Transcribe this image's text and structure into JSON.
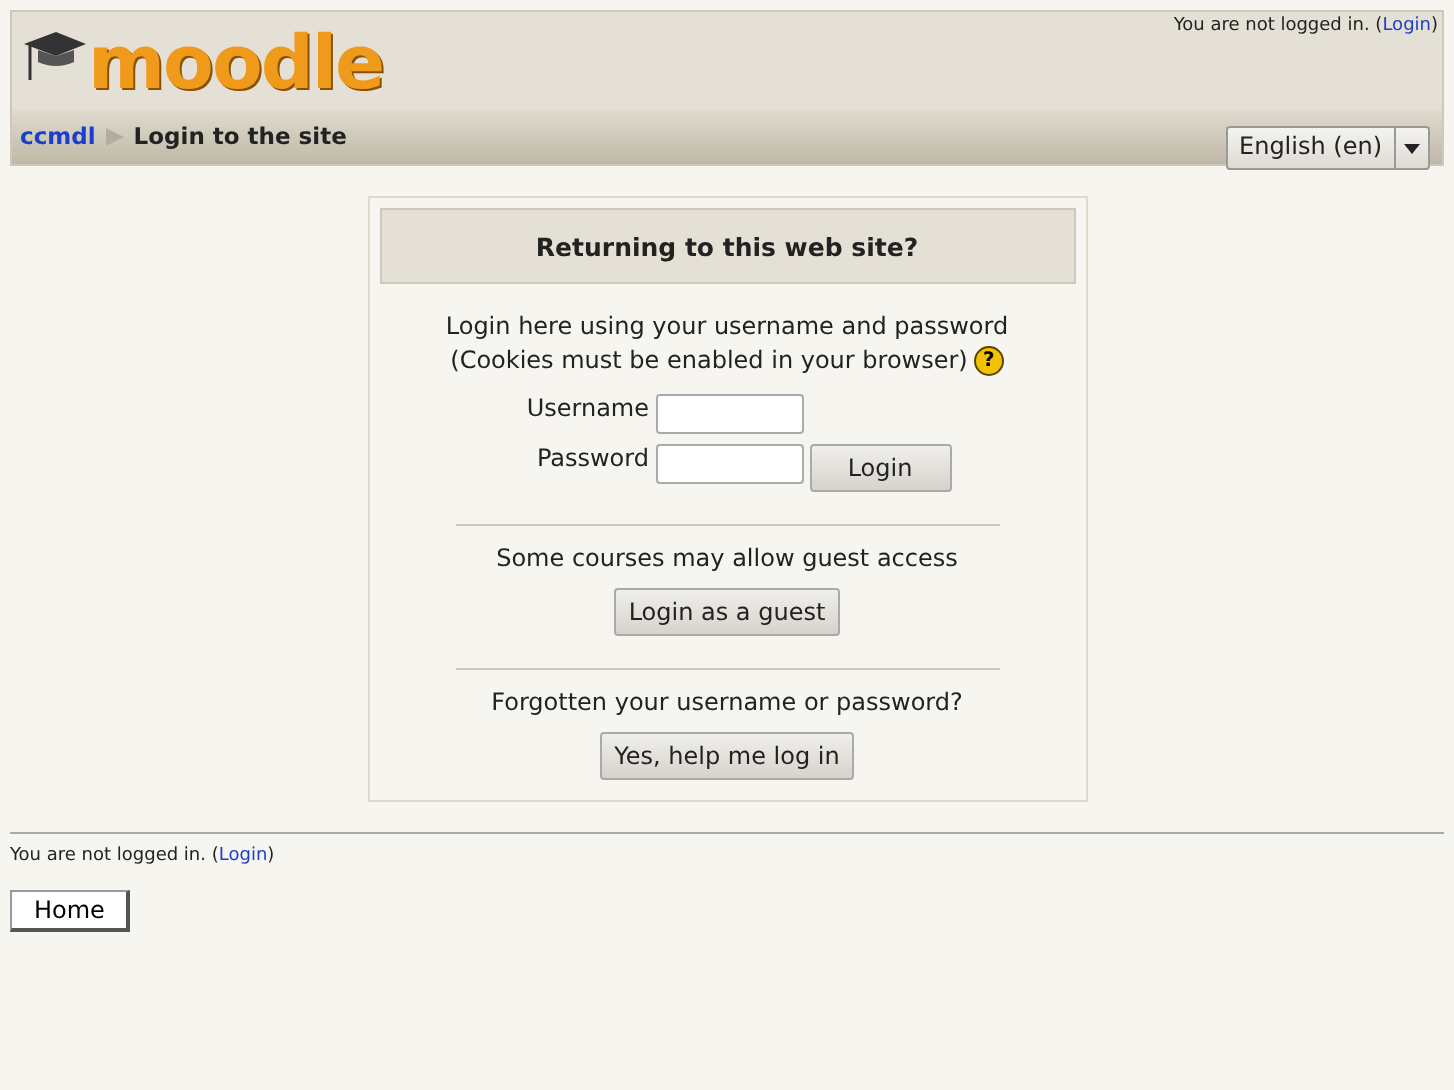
{
  "header": {
    "logo": "moodle",
    "login_info": {
      "prefix": "You are not logged in. (",
      "link": "Login",
      "suffix": ")"
    }
  },
  "navbar": {
    "breadcrumbs": [
      {
        "label": "ccmdl",
        "kind": "link"
      },
      {
        "label": "Login to the site",
        "kind": "current"
      }
    ],
    "language": "English (en)"
  },
  "login_box": {
    "title": "Returning to this web site?",
    "intro": [
      "Login here using your username and password",
      "(Cookies must be enabled in your browser)"
    ],
    "help_icon": "?",
    "fields": [
      {
        "label": "Username"
      },
      {
        "label": "Password"
      }
    ],
    "login_button": "Login",
    "guest_text": "Some courses may allow guest access",
    "guest_button": "Login as a guest",
    "forgot_text": "Forgotten your username or password?",
    "forgot_button": "Yes, help me log in"
  },
  "footer": {
    "login_info": {
      "prefix": "You are not logged in. (",
      "link": "Login",
      "suffix": ")"
    },
    "home_button": "Home"
  }
}
